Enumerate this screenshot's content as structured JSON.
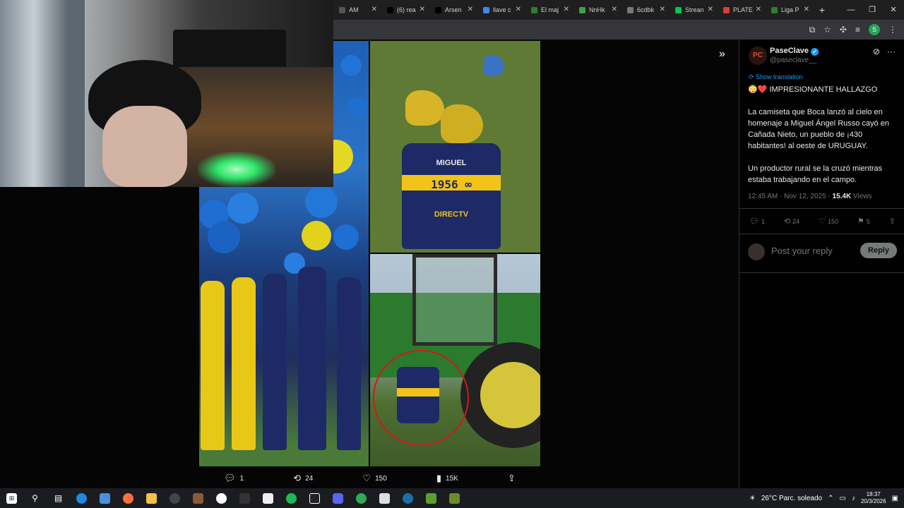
{
  "browser": {
    "tabs": [
      {
        "label": "AM",
        "color": "#555"
      },
      {
        "label": "(6) rea",
        "color": "#000"
      },
      {
        "label": "Arsen",
        "color": "#000"
      },
      {
        "label": "llave c",
        "color": "#4285f4"
      },
      {
        "label": "El maj",
        "color": "#2e7d32"
      },
      {
        "label": "NnHk",
        "color": "#43a047"
      },
      {
        "label": "6cdbk",
        "color": "#777"
      },
      {
        "label": "Strean",
        "color": "#00c853"
      },
      {
        "label": "PLATE",
        "color": "#e53935"
      },
      {
        "label": "Liga P",
        "color": "#2e7d32"
      }
    ],
    "new_tab": "+",
    "window_controls": {
      "minimize": "—",
      "restore": "❐",
      "close": "✕"
    },
    "profile_letter": "S"
  },
  "media_bar": {
    "replies": "1",
    "reposts": "24",
    "likes": "150",
    "views": "15K"
  },
  "tweet": {
    "author": "PaseClave",
    "handle": "@paseclave__",
    "avatar_text": "PC",
    "translate_label": "Show translation",
    "headline": "😳❤️ IMPRESIONANTE HALLAZGO",
    "paragraph1": "La camiseta que Boca lanzó al cielo en homenaje a Miguel Ángel Russo cayó en Cañada Nieto, un pueblo de ¡430 habitantes! al oeste de URUGUAY.",
    "paragraph2": "Un productor rural se la cruzó mientras estaba trabajando en el campo.",
    "time": "12:45 AM · Nov 12, 2025 · ",
    "views_count": "15.4K",
    "views_label": " Views",
    "stats": {
      "replies": "1",
      "reposts": "24",
      "likes": "150",
      "bookmarks": "5"
    },
    "reply_placeholder": "Post your reply",
    "reply_button": "Reply"
  },
  "shirt": {
    "name": "MIGUEL",
    "number": "1956 ∞",
    "sponsor": "DIRECTV"
  },
  "taskbar": {
    "weather": "26°C  Parc. soleado",
    "time": "18:37",
    "date": "20/3/2026"
  }
}
